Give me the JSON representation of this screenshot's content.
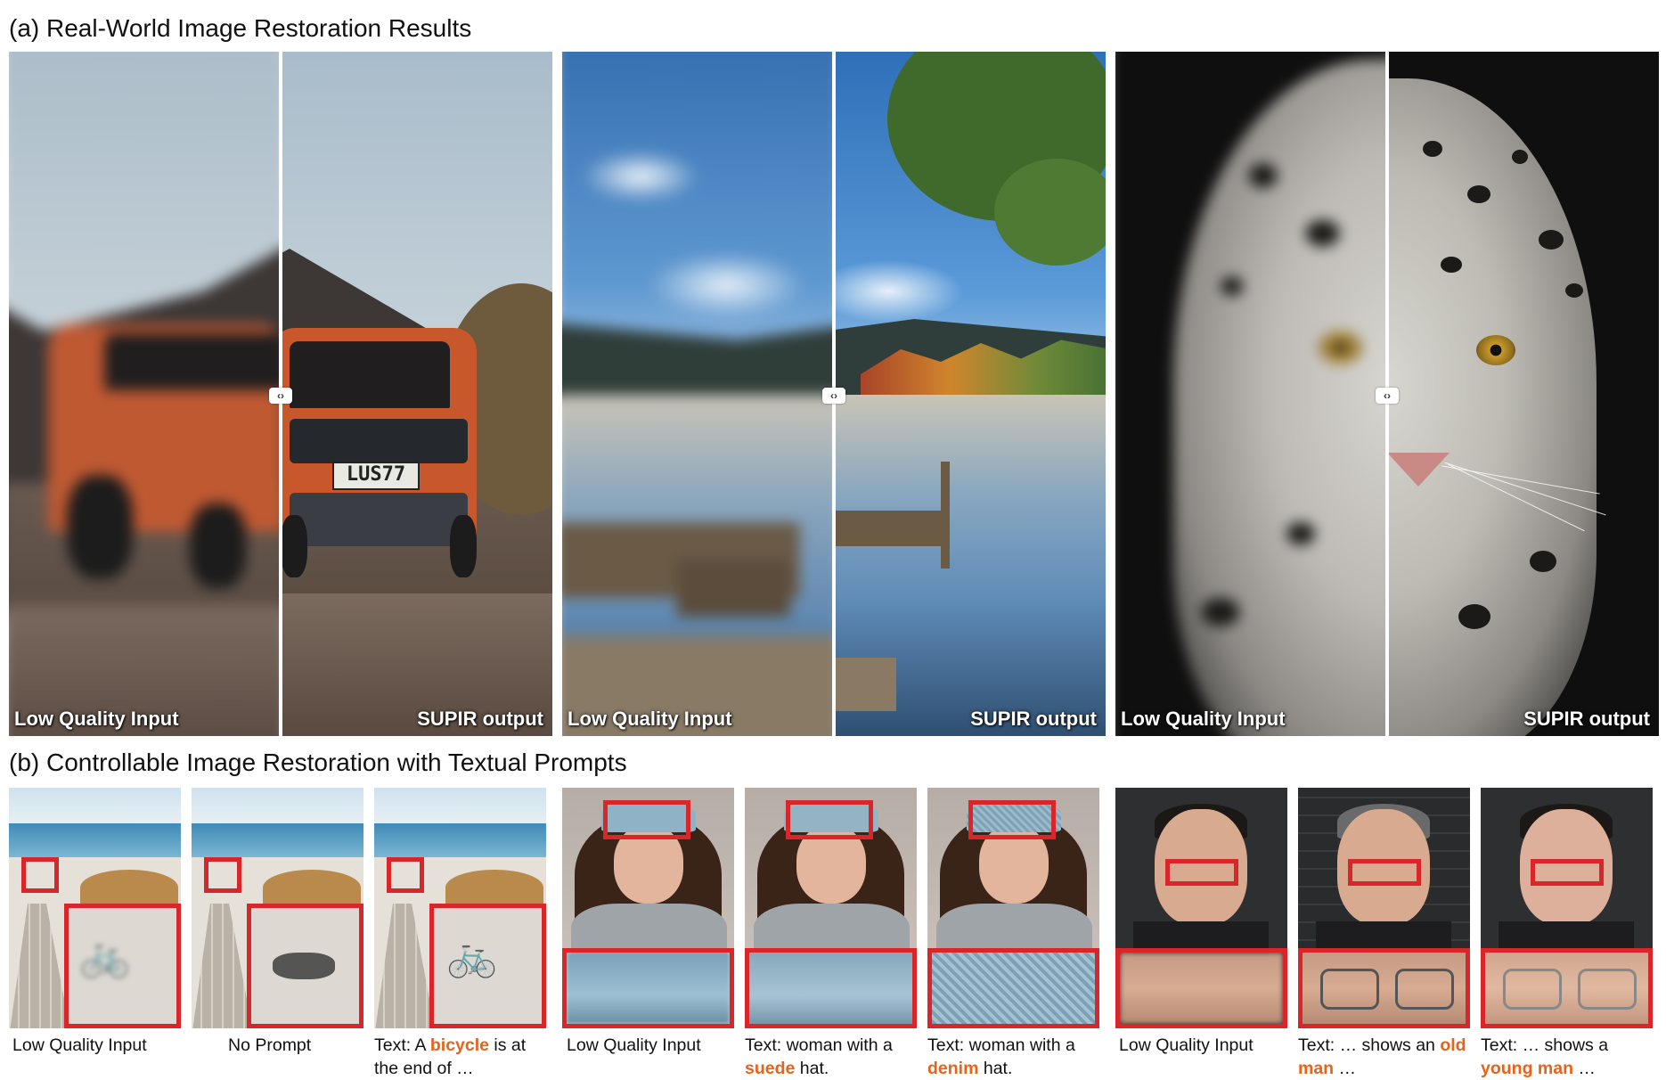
{
  "section_a": {
    "title": "(a) Real-World Image Restoration Results",
    "panels": [
      {
        "left_label": "Low Quality Input",
        "right_label": "SUPIR output",
        "plate_text": "LUS77"
      },
      {
        "left_label": "Low Quality Input",
        "right_label": "SUPIR output"
      },
      {
        "left_label": "Low Quality Input",
        "right_label": "SUPIR output"
      }
    ],
    "handle_glyph": "‹›"
  },
  "section_b": {
    "title": "(b) Controllable Image Restoration with Textual Prompts",
    "captions": [
      {
        "pre": "Low Quality Input",
        "hl": "",
        "post": ""
      },
      {
        "pre": "No Prompt",
        "hl": "",
        "post": ""
      },
      {
        "pre": "Text: A ",
        "hl": "bicycle",
        "post": " is at the end of …"
      },
      {
        "pre": "Low Quality Input",
        "hl": "",
        "post": ""
      },
      {
        "pre": "Text: woman with a ",
        "hl": "suede",
        "post": " hat."
      },
      {
        "pre": "Text: woman with a ",
        "hl": "denim",
        "post": " hat."
      },
      {
        "pre": "Low Quality Input",
        "hl": "",
        "post": ""
      },
      {
        "pre": "Text: … shows an ",
        "hl": "old man",
        "post": " …"
      },
      {
        "pre": "Text: … shows a ",
        "hl": "young man",
        "post": " …"
      }
    ]
  },
  "colors": {
    "highlight": "#e8631a",
    "inset_border": "#d8262a"
  }
}
